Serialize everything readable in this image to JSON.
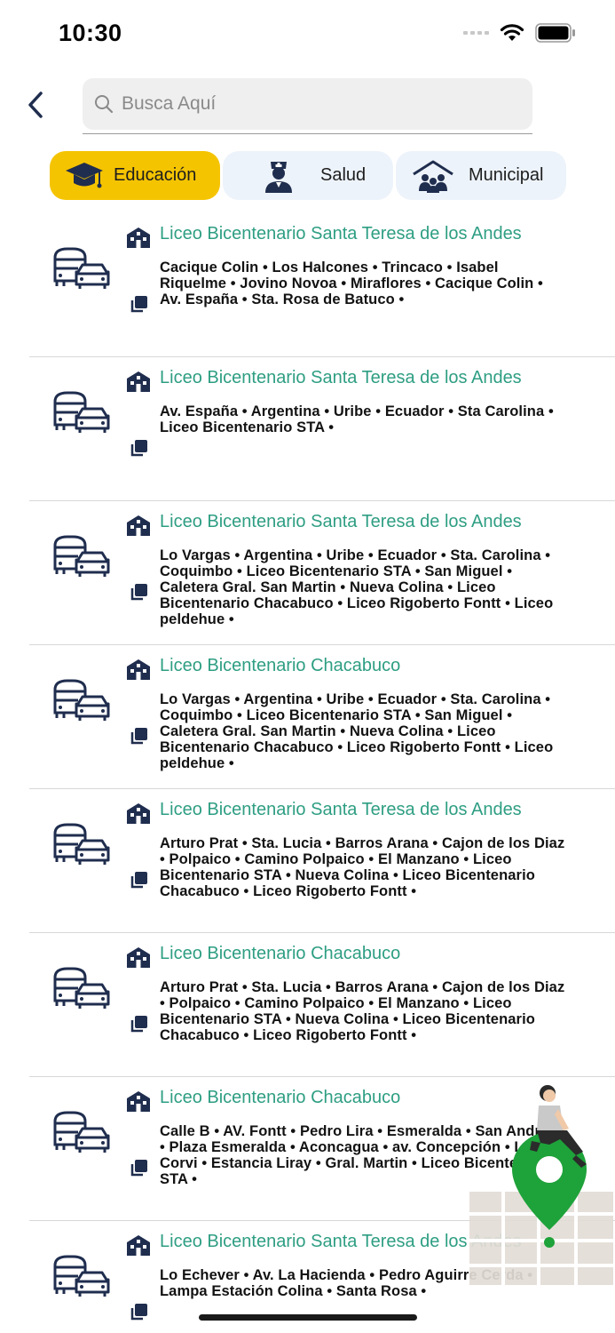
{
  "status_bar": {
    "time": "10:30"
  },
  "search": {
    "placeholder": "Busca Aquí",
    "value": ""
  },
  "categories": [
    {
      "label": "Educación",
      "icon": "graduation-cap-icon",
      "active": true
    },
    {
      "label": "Salud",
      "icon": "nurse-icon",
      "active": false
    },
    {
      "label": "Municipal",
      "icon": "municipal-building-icon",
      "active": false
    }
  ],
  "colors": {
    "accent": "#f5c400",
    "title_green": "#2e9e83",
    "chip_bg": "#edf3fa",
    "icon_navy": "#1f2d4e"
  },
  "routes": [
    {
      "title": "Liceo Bicentenario Santa Teresa de los Andes",
      "stops": "Cacique Colin •  Los Halcones •  Trincaco •  Isabel Riquelme •  Jovino Novoa •  Miraflores •  Cacique Colin •  Av. España •  Sta. Rosa de Batuco •"
    },
    {
      "title": "Liceo Bicentenario Santa Teresa de los Andes",
      "stops": "Av. España •  Argentina •  Uribe •  Ecuador •  Sta Carolina •  Liceo Bicentenario STA •"
    },
    {
      "title": "Liceo Bicentenario Santa Teresa de los Andes",
      "stops": "Lo Vargas •  Argentina •  Uribe •  Ecuador •  Sta. Carolina •  Coquimbo •  Liceo Bicentenario STA •  San Miguel •  Caletera Gral. San Martin •  Nueva Colina •  Liceo Bicentenario Chacabuco •  Liceo Rigoberto Fontt •  Liceo peldehue •"
    },
    {
      "title": "Liceo Bicentenario Chacabuco",
      "stops": "Lo Vargas •  Argentina •  Uribe •  Ecuador •  Sta. Carolina •  Coquimbo •  Liceo Bicentenario STA •  San Miguel •  Caletera Gral. San Martin •  Nueva Colina •  Liceo Bicentenario Chacabuco •  Liceo Rigoberto Fontt •  Liceo peldehue •"
    },
    {
      "title": "Liceo Bicentenario Santa Teresa de los Andes",
      "stops": "Arturo Prat •  Sta. Lucia •  Barros Arana •  Cajon de los Diaz •  Polpaico •  Camino Polpaico •  El Manzano •  Liceo Bicentenario STA •  Nueva Colina •  Liceo Bicentenario Chacabuco •  Liceo Rigoberto Fontt •"
    },
    {
      "title": "Liceo Bicentenario Chacabuco",
      "stops": "Arturo Prat •  Sta. Lucia •  Barros Arana •  Cajon de los Diaz •  Polpaico •  Camino Polpaico •  El Manzano •  Liceo Bicentenario STA •  Nueva Colina •  Liceo Bicentenario Chacabuco •  Liceo Rigoberto Fontt •"
    },
    {
      "title": "Liceo Bicentenario Chacabuco",
      "stops": "Calle B •  AV. Fontt •  Pedro Lira •  Esmeralda •  San Andres •  Plaza Esmeralda •  Aconcagua •  av. Concepción •  La Corvi •  Estancia Liray •  Gral. Martin •  Liceo Bicentenario STA •"
    },
    {
      "title": "Liceo Bicentenario Santa Teresa de los Andes",
      "stops": "Lo Echever •  Av. La Hacienda  •  Pedro Aguirre Cerda •  Lampa Estación Colina •  Santa Rosa •"
    }
  ]
}
